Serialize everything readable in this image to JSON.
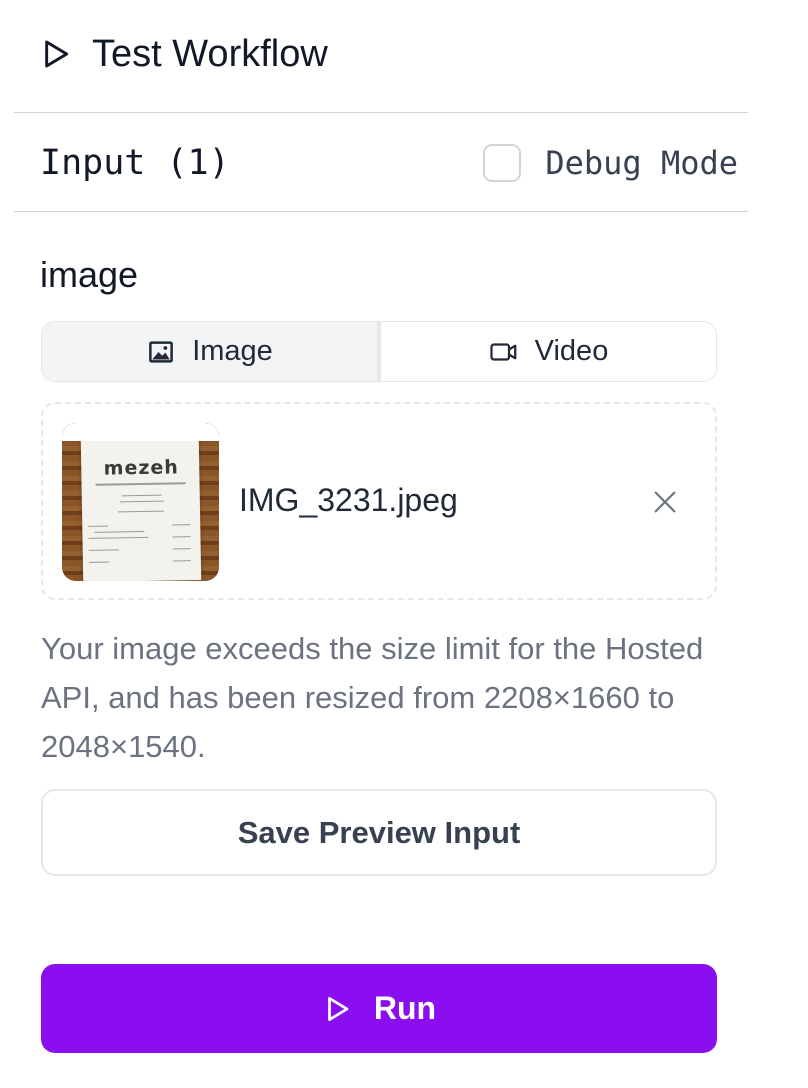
{
  "header": {
    "title": "Test Workflow",
    "icon": "play-outline-icon"
  },
  "input_section": {
    "title": "Input (1)",
    "debug_label": "Debug Mode",
    "debug_checked": false
  },
  "field": {
    "label": "image",
    "tabs": [
      {
        "label": "Image",
        "icon": "image-icon",
        "active": true
      },
      {
        "label": "Video",
        "icon": "video-camera-icon",
        "active": false
      }
    ],
    "file": {
      "name": "IMG_3231.jpeg",
      "thumbnail_text": "mezeh"
    },
    "message": "Your image exceeds the size limit for the Hosted API, and has been resized from 2208×1660 to 2048×1540."
  },
  "buttons": {
    "save_preview": "Save Preview Input",
    "run": "Run"
  },
  "colors": {
    "run_button": "#8a0ef0",
    "message_text": "#6b7280",
    "divider": "#d1d5db"
  }
}
